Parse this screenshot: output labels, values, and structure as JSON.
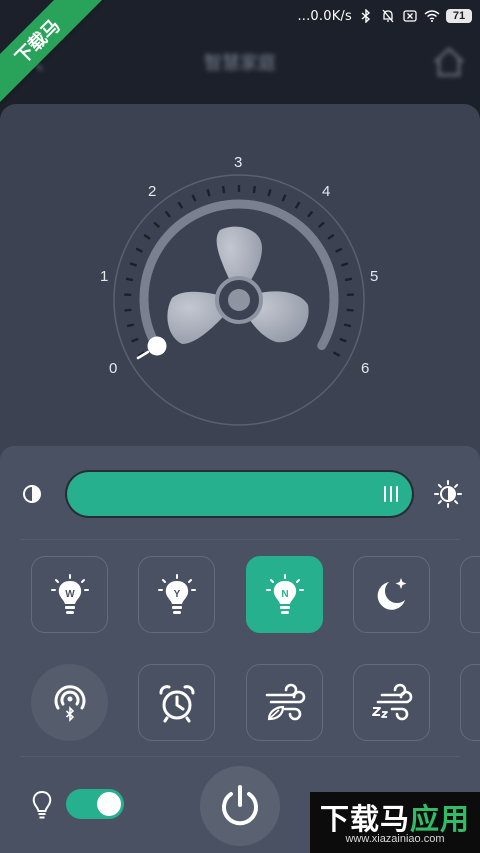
{
  "status_bar": {
    "network_speed": "...0.0K/s",
    "battery": "71"
  },
  "watermark": {
    "ribbon_text": "下载马",
    "logo_text_left": "下载马",
    "logo_text_right": "应用",
    "logo_url": "www.xiazainiao.com"
  },
  "header": {
    "title": "智慧家庭"
  },
  "fan_dial": {
    "scale_labels": [
      "0",
      "1",
      "2",
      "3",
      "4",
      "5",
      "6"
    ],
    "current_speed": 0
  },
  "brightness": {
    "level_percent": 100
  },
  "modes": [
    {
      "label": "W",
      "icon": "bulb-w-icon",
      "active": false
    },
    {
      "label": "Y",
      "icon": "bulb-y-icon",
      "active": false
    },
    {
      "label": "N",
      "icon": "bulb-n-icon",
      "active": true
    },
    {
      "label": "",
      "icon": "moon-icon",
      "active": false
    }
  ],
  "functions": [
    {
      "icon": "bluetooth-icon"
    },
    {
      "icon": "alarm-clock-icon"
    },
    {
      "icon": "wind-leaf-icon"
    },
    {
      "icon": "wind-sleep-icon"
    }
  ],
  "colors": {
    "accent": "#27b08e",
    "panel": "#4a5162",
    "sheet": "#3c4252",
    "background": "#1c202a"
  },
  "light_toggle": {
    "on": true
  }
}
